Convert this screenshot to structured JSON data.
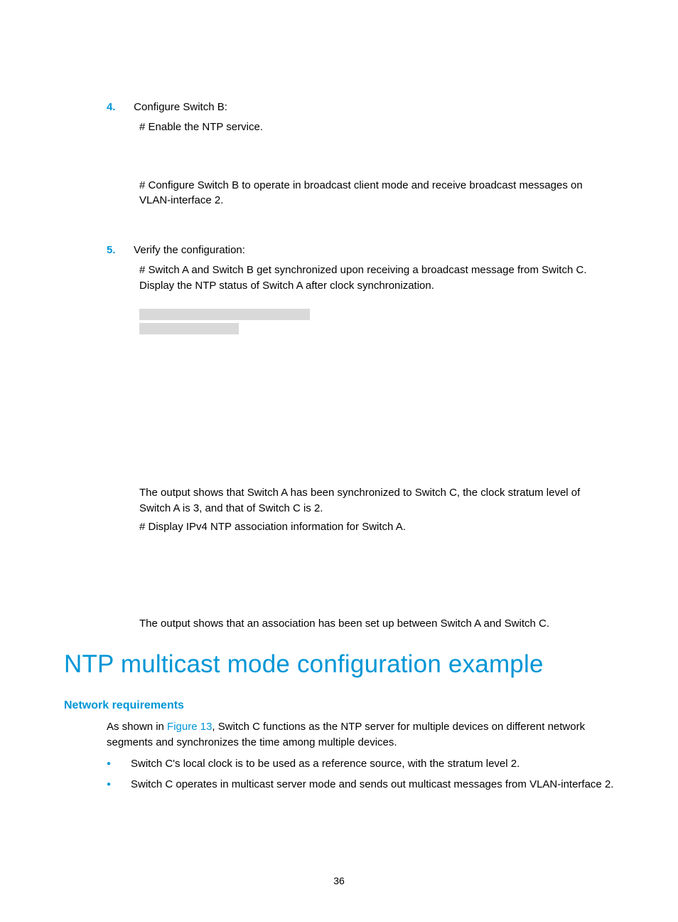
{
  "step4": {
    "num": "4.",
    "title": "Configure Switch B:",
    "line1": "# Enable the NTP service.",
    "line2": "# Configure Switch B to operate in broadcast client mode and receive broadcast messages on VLAN-interface 2."
  },
  "step5": {
    "num": "5.",
    "title": "Verify the configuration:",
    "line1": "# Switch A and Switch B get synchronized upon receiving a broadcast message from Switch C. Display the NTP status of Switch A after clock synchronization.",
    "line2": "The output shows that Switch A has been synchronized to Switch C, the clock stratum level of Switch A is 3, and that of Switch C is 2.",
    "line3": "# Display IPv4 NTP association information for Switch A.",
    "line4": "The output shows that an association has been set up between Switch A and Switch C."
  },
  "heading": "NTP multicast mode configuration example",
  "subheading": "Network requirements",
  "intro_prefix": "As shown in ",
  "intro_link": "Figure 13",
  "intro_suffix": ", Switch C functions as the NTP server for multiple devices on different network segments and synchronizes the time among multiple devices.",
  "bullet1": "Switch C's local clock is to be used as a reference source, with the stratum level 2.",
  "bullet2": "Switch C operates in multicast server mode and sends out multicast messages from VLAN-interface 2.",
  "page_number": "36"
}
